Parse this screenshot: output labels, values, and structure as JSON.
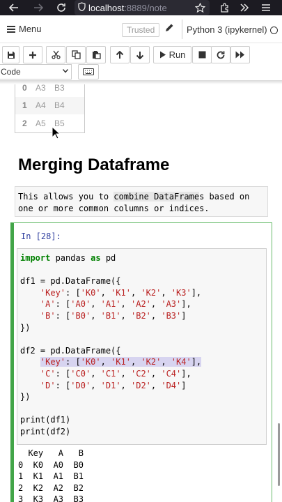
{
  "browser": {
    "url_host": "localhost",
    "url_path": ":8889/note",
    "icons": [
      "back-arrow-icon",
      "forward-arrow-icon",
      "reload-icon",
      "shield-icon",
      "star-icon",
      "extensions-icon",
      "overflow-icon",
      "menu-icon"
    ]
  },
  "menubar": {
    "menu_label": "Menu",
    "trusted_label": "Trusted",
    "kernel_label": "Python 3 (ipykernel)"
  },
  "toolbar": {
    "run_label": "Run",
    "cell_type": "Code"
  },
  "prev_output": {
    "rows": [
      {
        "idx": "0",
        "a": "A3",
        "b": "B3"
      },
      {
        "idx": "1",
        "a": "A4",
        "b": "B4"
      },
      {
        "idx": "2",
        "a": "A5",
        "b": "B5"
      }
    ]
  },
  "markdown": {
    "heading": "Merging Dataframe",
    "text_before": "This allows you to ",
    "text_highlight": "combine DataFrame",
    "text_after": "s based on",
    "text_line2": "one or more common columns or indices."
  },
  "cell": {
    "prompt": "In [28]:",
    "code": {
      "l1_kw": "import",
      "l1_a": " pandas ",
      "l1_kw2": "as",
      "l1_b": " pd",
      "l3": "df1 = pd.DataFrame({",
      "l4_a": "    ",
      "l4_s1": "'Key'",
      "l4_b": ": [",
      "l4_s2": "'K0'",
      "l4_c": ", ",
      "l4_s3": "'K1'",
      "l4_d": ", ",
      "l4_s4": "'K2'",
      "l4_e": ", ",
      "l4_s5": "'K3'",
      "l4_f": "],",
      "l5_a": "    ",
      "l5_s1": "'A'",
      "l5_b": ": [",
      "l5_s2": "'A0'",
      "l5_c": ", ",
      "l5_s3": "'A1'",
      "l5_d": ", ",
      "l5_s4": "'A2'",
      "l5_e": ", ",
      "l5_s5": "'A3'",
      "l5_f": "],",
      "l6_a": "    ",
      "l6_s1": "'B'",
      "l6_b": ": [",
      "l6_s2": "'B0'",
      "l6_c": ", ",
      "l6_s3": "'B1'",
      "l6_d": ", ",
      "l6_s4": "'B2'",
      "l6_e": ", ",
      "l6_s5": "'B3'",
      "l6_f": "]",
      "l7": "})",
      "l9": "df2 = pd.DataFrame({",
      "l10_a": "    ",
      "l10_s1": "'Key'",
      "l10_b": ": [",
      "l10_s2": "'K0'",
      "l10_c": ", ",
      "l10_s3": "'K1'",
      "l10_d": ", ",
      "l10_s4": "'K2'",
      "l10_e": ", ",
      "l10_s5": "'K4'",
      "l10_f": "],",
      "l11_a": "    ",
      "l11_s1": "'C'",
      "l11_b": ": [",
      "l11_s2": "'C0'",
      "l11_c": ", ",
      "l11_s3": "'C1'",
      "l11_d": ", ",
      "l11_s4": "'C2'",
      "l11_e": ", ",
      "l11_s5": "'C4'",
      "l11_f": "],",
      "l12_a": "    ",
      "l12_s1": "'D'",
      "l12_b": ": [",
      "l12_s2": "'D0'",
      "l12_c": ", ",
      "l12_s3": "'D1'",
      "l12_d": ", ",
      "l12_s4": "'D2'",
      "l12_e": ", ",
      "l12_s5": "'D4'",
      "l12_f": "]",
      "l13": "})",
      "l15": "print(df1)",
      "l16": "print(df2)"
    },
    "output_lines": [
      "  Key   A   B",
      "0  K0  A0  B0",
      "1  K1  A1  B1",
      "2  K2  A2  B2",
      "3  K3  A3  B3"
    ]
  }
}
